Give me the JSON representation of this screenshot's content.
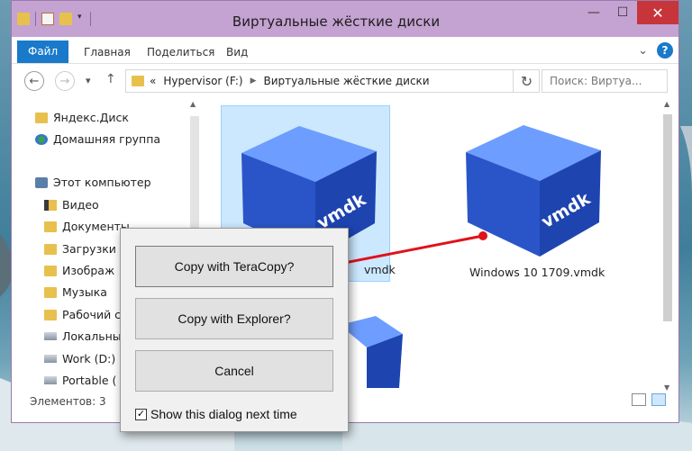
{
  "window": {
    "title": "Виртуальные жёсткие диски",
    "controls": {
      "minimize": "—",
      "maximize": "☐",
      "close": "✕"
    }
  },
  "ribbon": {
    "tabs": [
      "Файл",
      "Главная",
      "Поделиться",
      "Вид"
    ],
    "expand_icon": "chevron-down",
    "help": "?"
  },
  "address": {
    "prefix": "«",
    "crumbs": [
      "Hypervisor (F:)",
      "Виртуальные жёсткие диски"
    ],
    "search_placeholder": "Поиск: Виртуа..."
  },
  "nav": {
    "items": [
      {
        "label": "Яндекс.Диск",
        "icon": "folder"
      },
      {
        "label": "Домашняя группа",
        "icon": "homegroup"
      },
      {
        "label": "Этот компьютер",
        "icon": "pc"
      },
      {
        "label": "Видео",
        "icon": "folder-video"
      },
      {
        "label": "Документы",
        "icon": "folder-documents"
      },
      {
        "label": "Загрузки",
        "icon": "folder-downloads"
      },
      {
        "label": "Изображ",
        "icon": "folder-pictures"
      },
      {
        "label": "Музыка",
        "icon": "folder-music"
      },
      {
        "label": "Рабочий с",
        "icon": "folder-desktop"
      },
      {
        "label": "Локальны",
        "icon": "drive"
      },
      {
        "label": "Work (D:)",
        "icon": "drive"
      },
      {
        "label": "Portable (",
        "icon": "drive"
      }
    ]
  },
  "files": [
    {
      "label": "vmdk",
      "visible_name": "vmdk",
      "cube_text": "vmdk",
      "selected": true
    },
    {
      "label": "Windows 10 1709.vmdk",
      "cube_text": "vmdk",
      "selected": false
    }
  ],
  "status": {
    "count": "Элементов: 3"
  },
  "dialog": {
    "btn_teracopy": "Copy with TeraCopy?",
    "btn_explorer": "Copy with Explorer?",
    "btn_cancel": "Cancel",
    "checkbox_label": "Show this dialog next time",
    "checkbox_checked": true,
    "check_mark": "✓"
  },
  "colors": {
    "title_bar": "#c4a2d1",
    "file_tab": "#1979ca",
    "close_button": "#c7353a",
    "selection": "#cce8ff",
    "cube": "#2f5fd6",
    "arrow": "#e0121b"
  }
}
